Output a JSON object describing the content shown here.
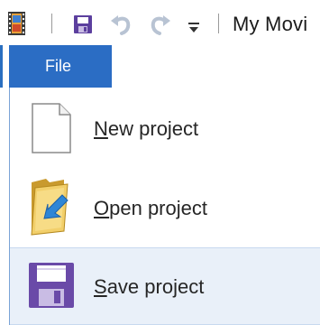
{
  "quick_access": {
    "app_icon": "film-strip-icon",
    "save_icon": "floppy-disk-icon",
    "undo_icon": "undo-arrow-icon",
    "redo_icon": "redo-arrow-icon",
    "customize_icon": "dropdown-arrow-icon",
    "title": "My Movi"
  },
  "tabs": {
    "file_label": "File"
  },
  "file_menu": {
    "items": [
      {
        "accel": "N",
        "rest": "ew project",
        "icon": "blank-document-icon"
      },
      {
        "accel": "O",
        "rest": "pen project",
        "icon": "open-folder-icon"
      },
      {
        "accel": "S",
        "rest": "ave project",
        "icon": "floppy-disk-icon"
      }
    ]
  },
  "colors": {
    "file_tab_bg": "#2b6dc4",
    "hover_bg": "#e9f0f9",
    "accent_purple": "#6a4aa8"
  }
}
